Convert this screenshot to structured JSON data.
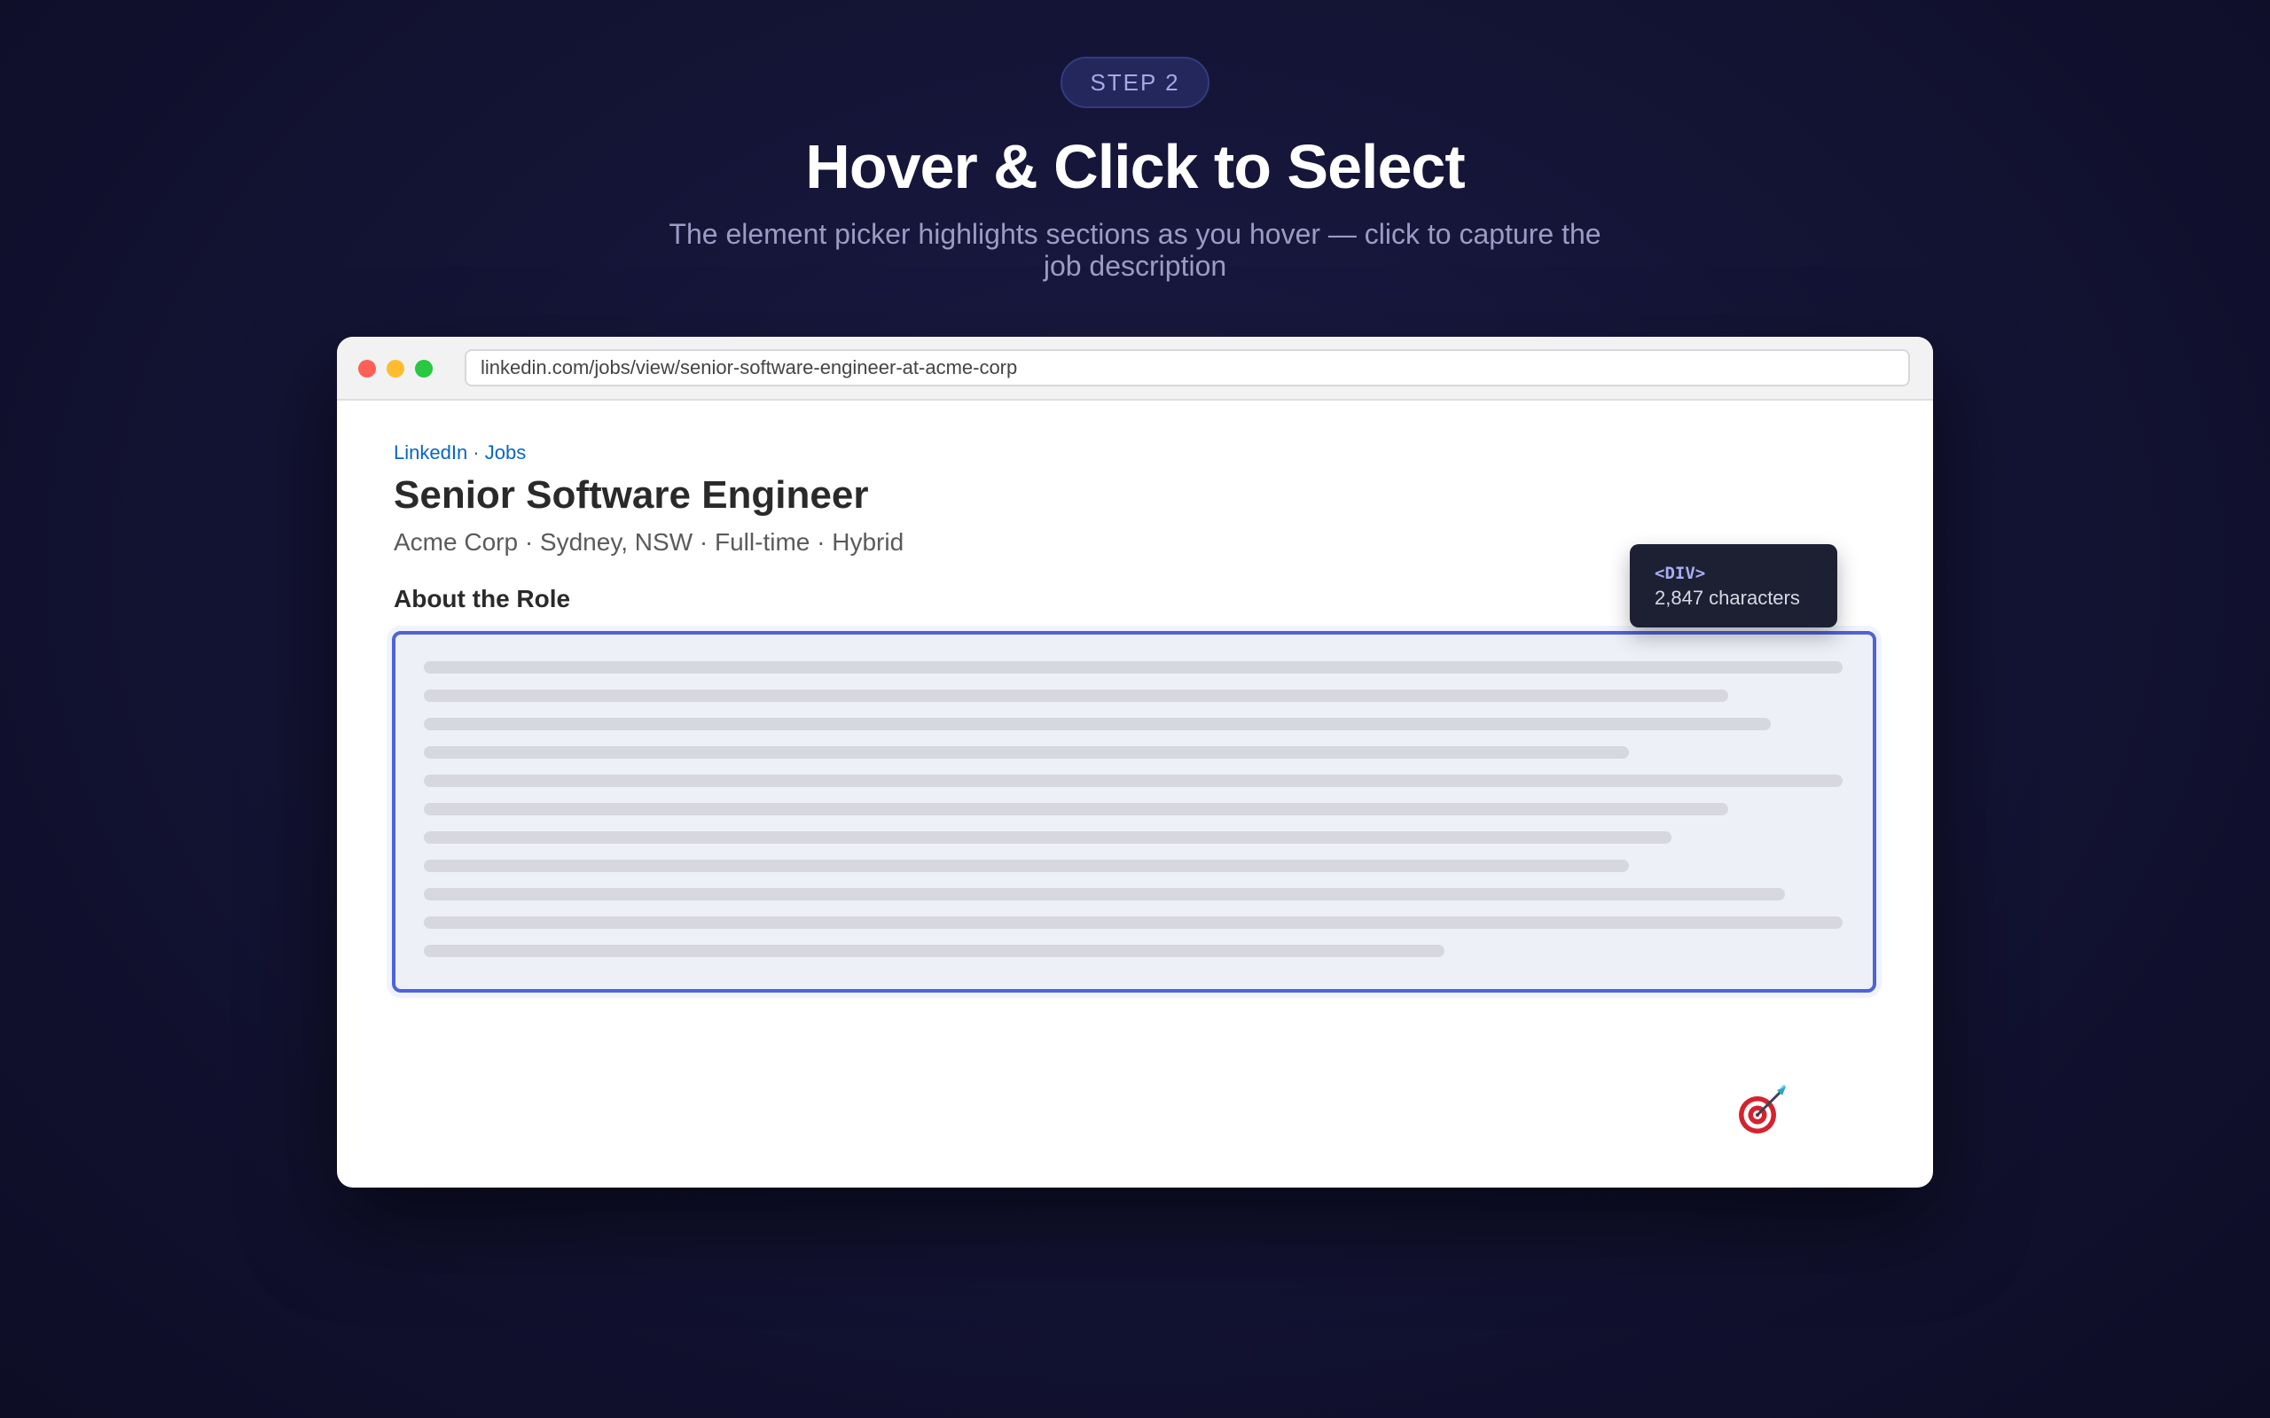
{
  "hero": {
    "step_label": "STEP 2",
    "title": "Hover & Click to Select",
    "subtitle": "The element picker highlights sections as you hover — click to capture the job description"
  },
  "browser": {
    "url": "linkedin.com/jobs/view/senior-software-engineer-at-acme-corp",
    "traffic_lights": [
      "#fe5f57",
      "#febc2e",
      "#28c840"
    ]
  },
  "job": {
    "breadcrumb": "LinkedIn · Jobs",
    "title": "Senior Software Engineer",
    "meta": "Acme Corp · Sydney, NSW · Full-time · Hybrid",
    "section_heading": "About the Role"
  },
  "tooltip": {
    "tag": "<DIV>",
    "count": "2,847 characters"
  },
  "colors": {
    "accent": "#4f63d8",
    "link": "#0a66c2",
    "highlight_bg": "#eef0f8"
  },
  "cursor": {
    "icon": "dart-target-icon"
  }
}
